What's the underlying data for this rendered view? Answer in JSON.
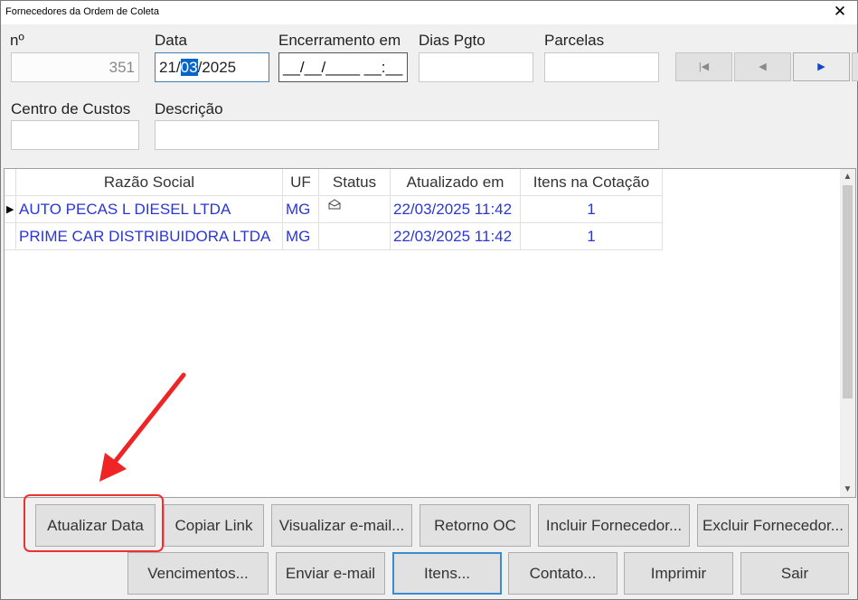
{
  "window": {
    "title": "Fornecedores da Ordem de Coleta",
    "close_glyph": "✕"
  },
  "form": {
    "numero_label": "nº",
    "numero_value": "351",
    "data_label": "Data",
    "data_pre": "21/",
    "data_sel": "03",
    "data_post": "/2025",
    "encerramento_label": "Encerramento em",
    "encerramento_value": "__/__/____ __:__",
    "dias_pgto_label": "Dias Pgto",
    "dias_pgto_value": "",
    "parcelas_label": "Parcelas",
    "parcelas_value": "",
    "centro_custos_label": "Centro de Custos",
    "centro_custos_value": "",
    "descricao_label": "Descrição",
    "descricao_value": ""
  },
  "nav": {
    "first_glyph": "|◀",
    "prev_glyph": "◀",
    "next_glyph": "▶",
    "last_glyph": "▶|"
  },
  "grid": {
    "columns": [
      "Razão Social",
      "UF",
      "Status",
      "Atualizado em",
      "Itens na Cotação"
    ],
    "rows": [
      {
        "razao_social": "AUTO PECAS L DIESEL LTDA",
        "uf": "MG",
        "status_icon": "envelope-icon",
        "atualizado": "22/03/2025 11:42",
        "itens": "1"
      },
      {
        "razao_social": "PRIME CAR DISTRIBUIDORA LTDA",
        "uf": "MG",
        "status_icon": "",
        "atualizado": "22/03/2025 11:42",
        "itens": "1"
      }
    ],
    "row_indicator": "▶",
    "scroll_up": "▲",
    "scroll_down": "▼"
  },
  "buttons": {
    "atualizar_data": "Atualizar Data",
    "copiar_link": "Copiar Link",
    "visualizar_email": "Visualizar e-mail...",
    "retorno_oc": "Retorno OC",
    "incluir_fornecedor": "Incluir Fornecedor...",
    "excluir_fornecedor": "Excluir Fornecedor...",
    "vencimentos": "Vencimentos...",
    "enviar_email": "Enviar e-mail",
    "itens": "Itens...",
    "contato": "Contato...",
    "imprimir": "Imprimir",
    "sair": "Sair"
  },
  "colors": {
    "highlight": "#ef3030",
    "link_text": "#2a36d8",
    "selection": "#0a64c8"
  }
}
